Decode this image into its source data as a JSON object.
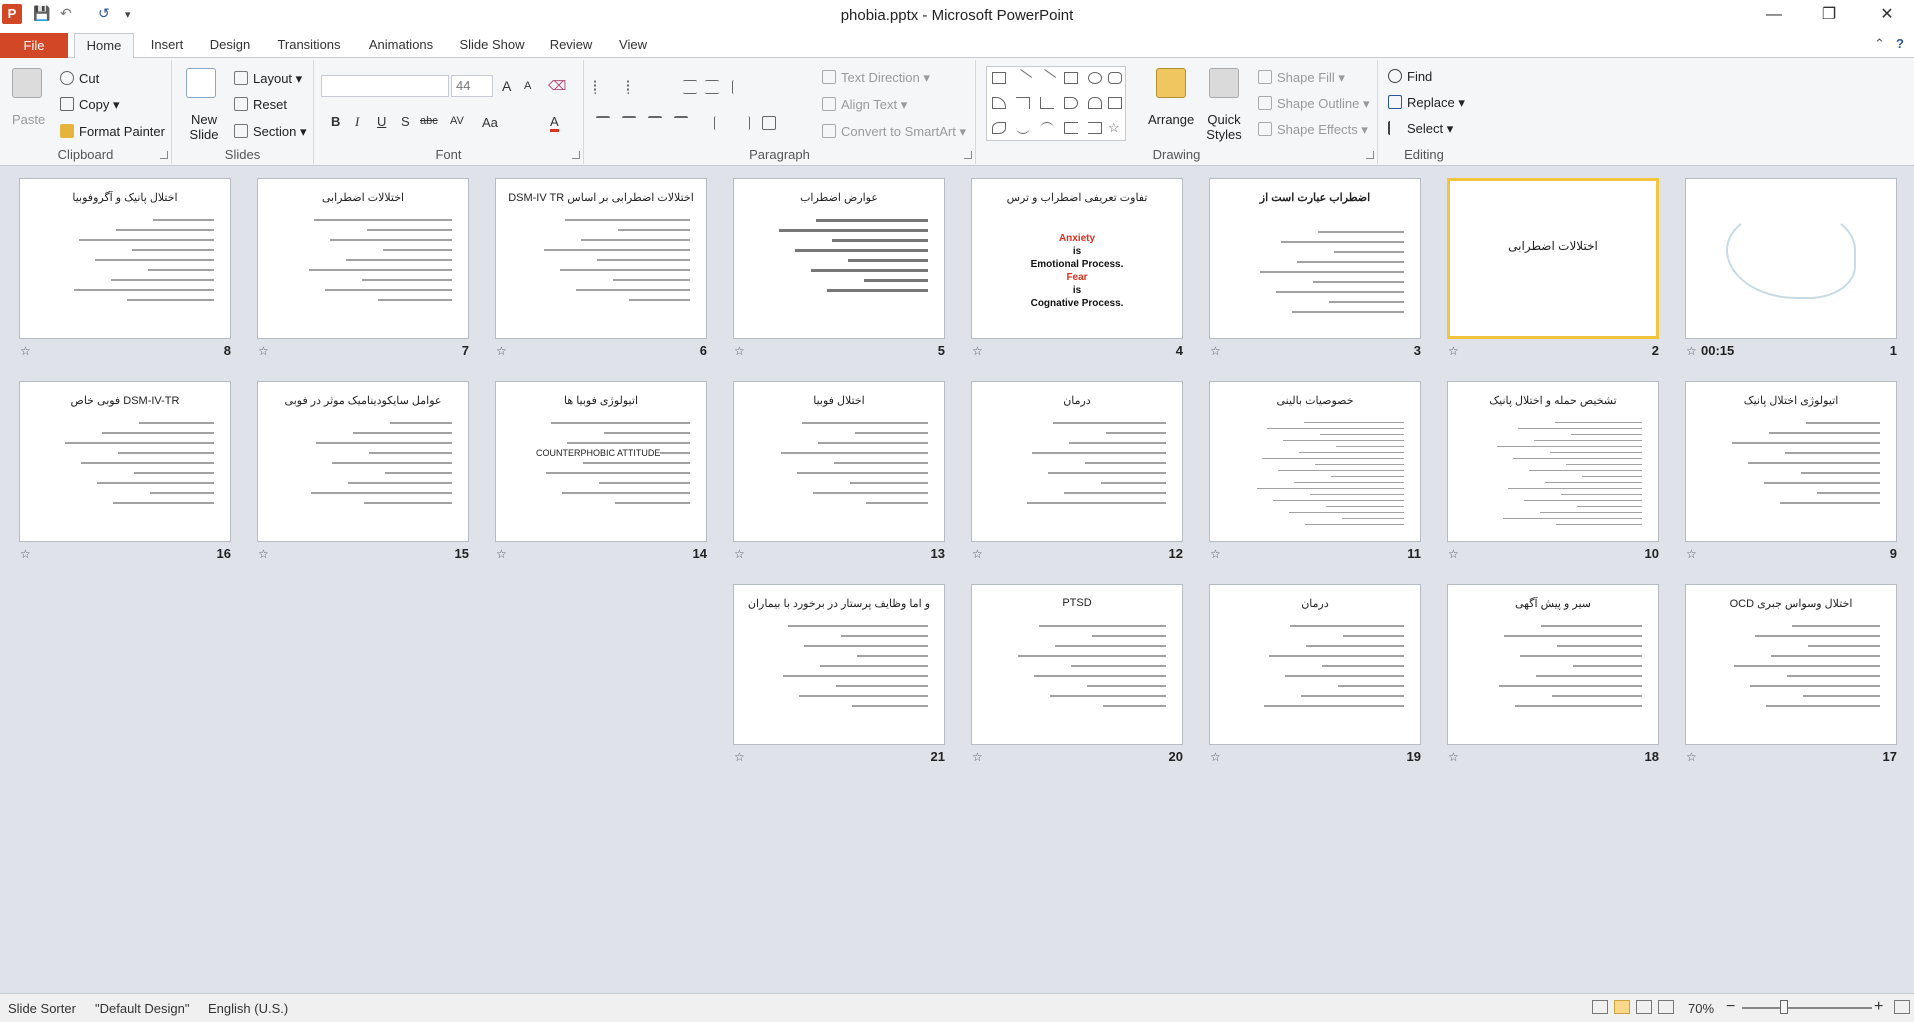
{
  "window": {
    "title": "phobia.pptx  -  Microsoft PowerPoint",
    "app_icon": "P",
    "qat": {
      "save_icon": "💾",
      "undo_icon": "↶",
      "redo_icon": "↺",
      "customize_icon": "▾"
    },
    "controls": {
      "minimize": "—",
      "maximize": "❐",
      "close": "✕"
    }
  },
  "tabs": {
    "file": "File",
    "items": [
      "Home",
      "Insert",
      "Design",
      "Transitions",
      "Animations",
      "Slide Show",
      "Review",
      "View"
    ],
    "active": "Home",
    "collapse_icon": "⌃",
    "help_icon": "?"
  },
  "ribbon": {
    "clipboard": {
      "label": "Clipboard",
      "paste": "Paste",
      "cut": "Cut",
      "copy": "Copy",
      "format_painter": "Format Painter"
    },
    "slides": {
      "label": "Slides",
      "new_slide": "New Slide",
      "layout": "Layout",
      "reset": "Reset",
      "section": "Section"
    },
    "font": {
      "label": "Font",
      "font_name": "",
      "font_size": "44",
      "grow": "A",
      "shrink": "A",
      "clear": "⌫",
      "bold": "B",
      "italic": "I",
      "underline": "U",
      "strike": "S",
      "strikethrough": "abc",
      "spacing": "AV",
      "case": "Aa",
      "color": "A"
    },
    "paragraph": {
      "label": "Paragraph",
      "text_direction": "Text Direction",
      "align_text": "Align Text",
      "convert_smartart": "Convert to SmartArt"
    },
    "drawing": {
      "label": "Drawing",
      "arrange": "Arrange",
      "quick_styles": "Quick Styles",
      "shape_fill": "Shape Fill",
      "shape_outline": "Shape Outline",
      "shape_effects": "Shape Effects"
    },
    "editing": {
      "label": "Editing",
      "find": "Find",
      "replace": "Replace",
      "select": "Select"
    }
  },
  "slides": [
    {
      "num": "1",
      "title": "",
      "timing": "00:15",
      "kind": "calligraphy"
    },
    {
      "num": "2",
      "title": "اختلالات اضطرابی",
      "kind": "title-only",
      "selected": true
    },
    {
      "num": "3",
      "title": "اضطراب عبارت است از",
      "kind": "text"
    },
    {
      "num": "4",
      "title": "تفاوت تعریفی اضطراب و ترس",
      "kind": "anxiety",
      "lines": [
        "Anxiety",
        "is",
        "Emotional Process.",
        "Fear",
        "is",
        "Cognative Process."
      ]
    },
    {
      "num": "5",
      "title": "عوارض اضطراب",
      "kind": "bold-text"
    },
    {
      "num": "6",
      "title": "اختلالات اضطرابی بر اساس DSM-IV TR",
      "kind": "list"
    },
    {
      "num": "7",
      "title": "اختلالات اضطرابی",
      "kind": "list"
    },
    {
      "num": "8",
      "title": "اختلال پانیک و آگروفوبیا",
      "kind": "text"
    },
    {
      "num": "9",
      "title": "اتیولوژی اختلال پانیک",
      "kind": "list"
    },
    {
      "num": "10",
      "title": "تشخیص حمله و اختلال پانیک",
      "kind": "dense"
    },
    {
      "num": "11",
      "title": "خصوصیات بالینی",
      "kind": "dense"
    },
    {
      "num": "12",
      "title": "درمان",
      "kind": "list"
    },
    {
      "num": "13",
      "title": "اختلال فوبیا",
      "kind": "text"
    },
    {
      "num": "14",
      "title": "اتیولوژی فوبیا ها",
      "kind": "list",
      "inline_text": "COUNTERPHOBIC ATTITUDE"
    },
    {
      "num": "15",
      "title": "عوامل سایکودینامیک موثر در فوبی",
      "kind": "list"
    },
    {
      "num": "16",
      "title": "DSM-IV-TR فوبی خاص",
      "kind": "list"
    },
    {
      "num": "17",
      "title": "اختلال وسواس جبری OCD",
      "kind": "list"
    },
    {
      "num": "18",
      "title": "سیر و پیش آگهی",
      "kind": "list"
    },
    {
      "num": "19",
      "title": "درمان",
      "kind": "list"
    },
    {
      "num": "20",
      "title": "PTSD",
      "kind": "list"
    },
    {
      "num": "21",
      "title": "و اما وظایف پرستار در برخورد با بیماران",
      "kind": "list"
    }
  ],
  "star_icon": "☆",
  "status": {
    "view": "Slide Sorter",
    "theme": "\"Default Design\"",
    "language": "English (U.S.)",
    "zoom": "70%",
    "zoom_out": "−",
    "zoom_in": "+"
  },
  "colors": {
    "file_tab": "#d24726",
    "accent": "#2b579a",
    "selection": "#f3c53f",
    "anxiety_red": "#e0301e"
  }
}
